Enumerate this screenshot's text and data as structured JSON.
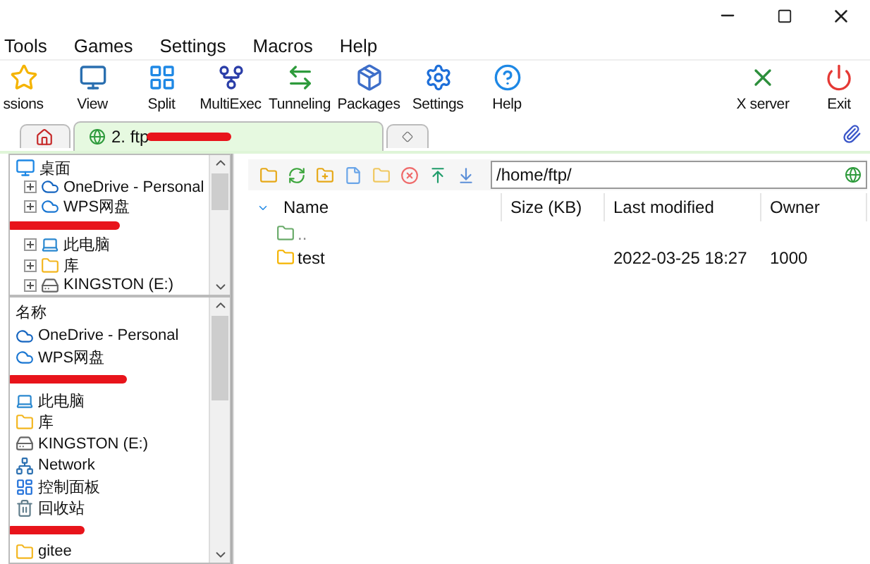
{
  "menu": [
    "Tools",
    "Games",
    "Settings",
    "Macros",
    "Help"
  ],
  "toolbar_left": [
    "ssions",
    "View",
    "Split",
    "MultiExec",
    "Tunneling",
    "Packages",
    "Settings",
    "Help"
  ],
  "toolbar_right": [
    "X server",
    "Exit"
  ],
  "tabs": [
    {
      "kind": "home",
      "selected": false
    },
    {
      "kind": "session",
      "label": "2. ftp",
      "selected": true
    },
    {
      "kind": "new",
      "selected": false
    }
  ],
  "folder_tree": {
    "label": "桌面",
    "children": [
      {
        "kind": "item",
        "label": "OneDrive - Personal",
        "expanded": false
      },
      {
        "kind": "item",
        "label": "WPS网盘",
        "expanded": false
      },
      {
        "kind": "redacted"
      },
      {
        "kind": "item",
        "label": "此电脑",
        "expanded": false
      },
      {
        "kind": "item",
        "label": "库",
        "expanded": false
      },
      {
        "kind": "item",
        "label": "KINGSTON (E:)",
        "expanded": false
      }
    ]
  },
  "file_list": {
    "header": "名称",
    "items": [
      {
        "kind": "item",
        "label": "OneDrive - Personal"
      },
      {
        "kind": "item",
        "label": "WPS网盘"
      },
      {
        "kind": "redacted"
      },
      {
        "kind": "item",
        "label": "此电脑"
      },
      {
        "kind": "item",
        "label": "库"
      },
      {
        "kind": "item",
        "label": "KINGSTON (E:)"
      },
      {
        "kind": "item",
        "label": "Network"
      },
      {
        "kind": "item",
        "label": "控制面板"
      },
      {
        "kind": "item",
        "label": "回收站"
      },
      {
        "kind": "redacted"
      },
      {
        "kind": "item",
        "label": "gitee"
      }
    ]
  },
  "remote": {
    "path": "/home/ftp/",
    "columns": [
      "Name",
      "Size (KB)",
      "Last modified",
      "Owner"
    ],
    "rows": [
      {
        "kind": "parent",
        "name": "..",
        "size": "",
        "modified": "",
        "owner": ""
      },
      {
        "kind": "folder",
        "name": "test",
        "size": "",
        "modified": "2022-03-25 18:27",
        "owner": "1000"
      }
    ]
  }
}
